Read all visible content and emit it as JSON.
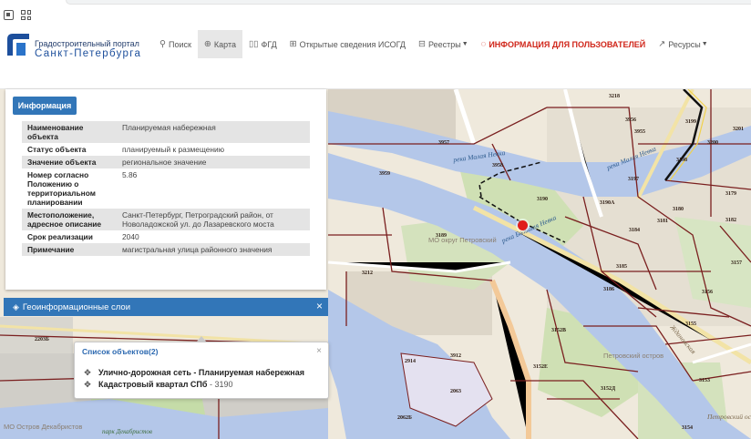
{
  "brand": {
    "line1": "Градостроительный портал",
    "line2": "Санкт-Петербурга"
  },
  "nav": [
    {
      "label": "Поиск",
      "icon": "search-icon"
    },
    {
      "label": "Карта",
      "icon": "globe-icon"
    },
    {
      "label": "ФГД",
      "icon": "book-icon"
    },
    {
      "label": "Открытые сведения ИСОГД",
      "icon": "plus-square-icon"
    },
    {
      "label": "Реестры",
      "icon": "table-icon"
    },
    {
      "label": "ИНФОРМАЦИЯ ДЛЯ ПОЛЬЗОВАТЕЛЕЙ",
      "icon": "chat-icon"
    },
    {
      "label": "Ресурсы",
      "icon": "external-link-icon"
    }
  ],
  "info": {
    "tab": "Информация",
    "rows": [
      {
        "key": "Наименование объекта",
        "value": "Планируемая набережная"
      },
      {
        "key": "Статус объекта",
        "value": "планируемый к размещению"
      },
      {
        "key": "Значение объекта",
        "value": "региональное значение"
      },
      {
        "key": "Номер согласно Положению о территориальном планировании",
        "value": "5.86"
      },
      {
        "key": "Местоположение, адресное описание",
        "value": "Санкт-Петербург, Петроградский район, от Новоладожской ул. до Лазаревского моста"
      },
      {
        "key": "Срок реализации",
        "value": "2040"
      },
      {
        "key": "Примечание",
        "value": "магистральная улица районного значения"
      }
    ]
  },
  "layers": {
    "title": "Геоинформационные слои",
    "close": "×"
  },
  "objects": {
    "title": "Список объектов(2)",
    "close": "×",
    "items": [
      {
        "bold": "Улично-дорожная сеть - Планируемая набережная",
        "num": ""
      },
      {
        "bold": "Кадастровый квартал СПб",
        "num": "- 3190"
      }
    ]
  },
  "map": {
    "quarters": [
      "3218",
      "3956",
      "3955",
      "3199",
      "3201",
      "3200",
      "3957",
      "3958",
      "3198",
      "3959",
      "3197",
      "3179",
      "3190",
      "3190A",
      "3180",
      "3181",
      "3189",
      "3184",
      "3182",
      "3212",
      "3185",
      "3157",
      "3186",
      "3156",
      "3152B",
      "3152E",
      "3155",
      "3912",
      "3152Д",
      "3153",
      "2914",
      "2063",
      "2062Б",
      "2203Б",
      "3154"
    ],
    "rivers": [
      "река Малая Невка",
      "река Малая Невка",
      "река Большая Невка"
    ],
    "districts": [
      "МО округ Петровский",
      "МО Остров Декабристов",
      "Петровский остров"
    ],
    "parks": [
      "парк Декабристов"
    ],
    "fragments": [
      "Ждановская",
      "Петровский остров"
    ]
  }
}
